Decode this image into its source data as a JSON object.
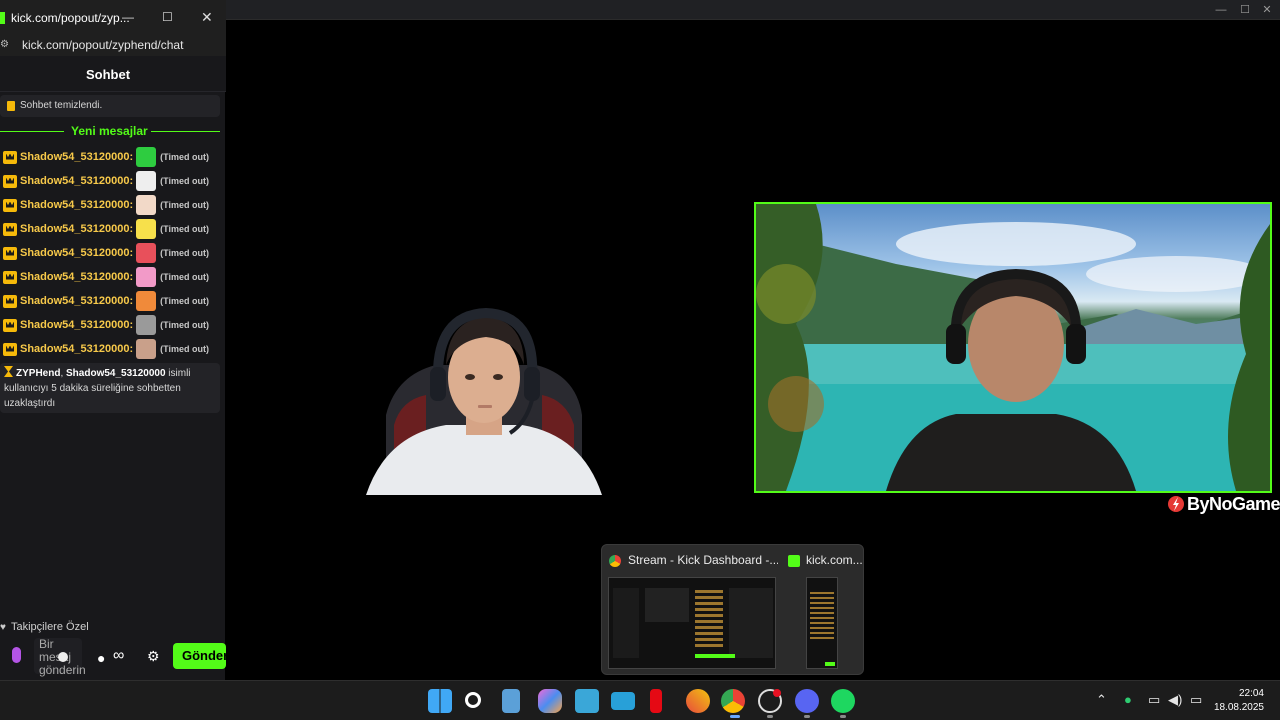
{
  "main_window": {
    "controls": [
      "—",
      "☐",
      "✕"
    ]
  },
  "brand": {
    "logo_text": "ByNoGame"
  },
  "task_preview": {
    "items": [
      {
        "title": "Stream - Kick Dashboard -..."
      },
      {
        "title": "kick.com..."
      }
    ]
  },
  "chat": {
    "window_title": "kick.com/popout/zyp...",
    "address": "kick.com/popout/zyphend/chat",
    "header": "Sohbet",
    "system_message": "Sohbet temizlendi.",
    "divider": "Yeni mesajlar",
    "messages": [
      {
        "user": "Shadow54_53120000:",
        "status": "(Timed out)"
      },
      {
        "user": "Shadow54_53120000:",
        "status": "(Timed out)"
      },
      {
        "user": "Shadow54_53120000:",
        "status": "(Timed out)"
      },
      {
        "user": "Shadow54_53120000:",
        "status": "(Timed out)"
      },
      {
        "user": "Shadow54_53120000:",
        "status": "(Timed out)"
      },
      {
        "user": "Shadow54_53120000:",
        "status": "(Timed out)"
      },
      {
        "user": "Shadow54_53120000:",
        "status": "(Timed out)"
      },
      {
        "user": "Shadow54_53120000:",
        "status": "(Timed out)"
      },
      {
        "user": "Shadow54_53120000:",
        "status": "(Timed out)"
      }
    ],
    "mod_action": {
      "moderator": "ZYPHend",
      "sep": ", ",
      "target": "Shadow54_53120000",
      "text": " isimli kullanıcıyı 5 dakika süreliğine sohbetten uzaklaştırdı"
    },
    "followers_only": "Takipçilere Özel",
    "input_placeholder": "Bir mesaj gönderin",
    "send_label": "Gönder"
  },
  "taskbar": {
    "time": "22:04",
    "date": "18.08.2025"
  }
}
